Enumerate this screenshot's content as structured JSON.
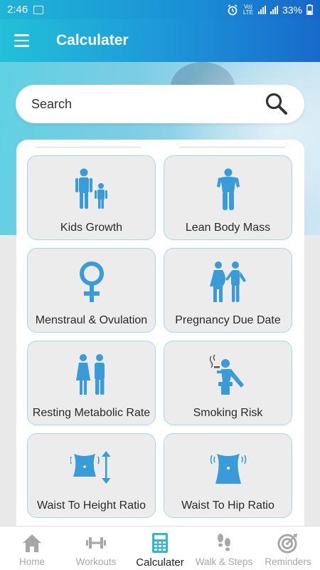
{
  "status_bar": {
    "time": "2:46",
    "network": "Vo) LTE",
    "battery": "33%"
  },
  "app_bar": {
    "title": "Calculater",
    "menu_icon": "hamburger-menu-icon"
  },
  "search": {
    "placeholder": "Search",
    "icon": "magnifier-icon"
  },
  "calculators": [
    {
      "label": "Kids Growth",
      "icon": "parent-child-icon"
    },
    {
      "label": "Lean Body Mass",
      "icon": "muscle-man-icon"
    },
    {
      "label": "Menstraul & Ovulation",
      "icon": "female-symbol-icon"
    },
    {
      "label": "Pregnancy Due Date",
      "icon": "pregnant-couple-icon"
    },
    {
      "label": "Resting Metabolic Rate",
      "icon": "woman-man-icon"
    },
    {
      "label": "Smoking Risk",
      "icon": "smoking-person-icon"
    },
    {
      "label": "Waist To Height Ratio",
      "icon": "waist-height-icon"
    },
    {
      "label": "Waist To Hip Ratio",
      "icon": "waist-hip-icon"
    }
  ],
  "bottom_nav": [
    {
      "label": "Home",
      "icon": "home-icon",
      "active": false
    },
    {
      "label": "Workouts",
      "icon": "dumbbell-icon",
      "active": false
    },
    {
      "label": "Calculater",
      "icon": "calculator-icon",
      "active": true
    },
    {
      "label": "Walk & Steps",
      "icon": "footsteps-icon",
      "active": false
    },
    {
      "label": "Reminders",
      "icon": "target-icon",
      "active": false
    }
  ],
  "colors": {
    "accent": "#1d94d8",
    "icon_blue": "#3a9bd9",
    "tile_bg": "#ececec",
    "tile_border": "#a9d6e6",
    "nav_inactive": "#a7a7a7"
  }
}
